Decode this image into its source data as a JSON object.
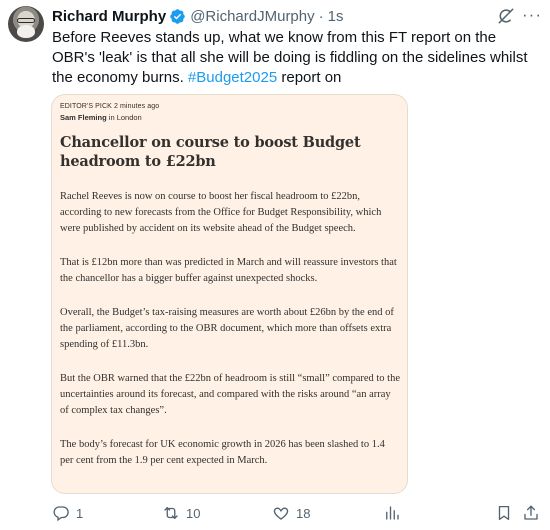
{
  "tweet": {
    "author_name": "Richard Murphy",
    "handle": "@RichardJMurphy",
    "separator": "·",
    "time": "1s",
    "text_before_hashtag": "Before Reeves stands up, what we know from this FT report on the OBR's 'leak' is that all she will be doing is fiddling on the sidelines whilst the economy burns.",
    "hashtag": "#Budget2025",
    "text_after_hashtag": " report on"
  },
  "card": {
    "meta_pick": "EDITOR'S PICK 2 minutes ago",
    "author": "Sam Fleming",
    "location": " in London",
    "title": "Chancellor on course to boost Budget headroom to £22bn",
    "paragraphs": [
      "Rachel Reeves is now on course to boost her fiscal headroom to £22bn, according to new forecasts from the Office for Budget Responsibility, which were published by accident on its website ahead of the Budget speech.",
      "That is £12bn more than was predicted in March and will reassure investors that the chancellor has a bigger buffer against unexpected shocks.",
      "Overall, the Budget’s tax-raising measures are worth about £26bn by the end of the parliament, according to the OBR document, which more than offsets extra spending of £11.3bn.",
      "But the OBR warned that the £22bn of headroom is still “small” compared to the uncertainties around its forecast, and compared with the risks around “an array of complex tax changes”.",
      "The body’s forecast for UK economic growth in 2026 has been slashed to 1.4 per cent from the 1.9 per cent expected in March."
    ]
  },
  "actions": {
    "replies": "1",
    "reposts": "10",
    "likes": "18",
    "views": ""
  },
  "icons": {
    "verified": "verified-badge-icon",
    "grok": "grok-icon",
    "more": "more-icon",
    "reply": "reply-icon",
    "repost": "repost-icon",
    "like": "heart-icon",
    "views": "views-icon",
    "bookmark": "bookmark-icon",
    "share": "share-icon"
  },
  "colors": {
    "accent": "#1d9bf0",
    "muted": "#536471",
    "card_background": "#fff1e5"
  }
}
